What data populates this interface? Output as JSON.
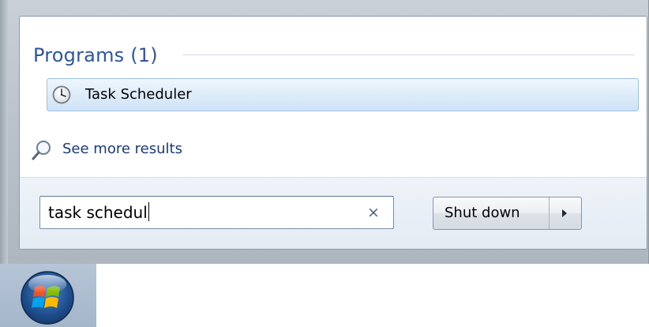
{
  "results": {
    "group_header": "Programs (1)",
    "programs": [
      {
        "label": "Task Scheduler",
        "icon": "clock-icon"
      }
    ],
    "see_more_label": "See more results",
    "see_more_icon": "magnifier-icon"
  },
  "search": {
    "value": "task schedul",
    "clear_icon": "×"
  },
  "power": {
    "shutdown_label": "Shut down",
    "options_icon": "triangle-right-icon"
  },
  "taskbar": {
    "start_icon": "windows-start-orb-icon"
  },
  "colors": {
    "header_blue": "#2e55a0",
    "link_blue": "#1a3a7a",
    "highlight_border": "#9fc2e6",
    "highlight_fill": "#dcebf9"
  }
}
